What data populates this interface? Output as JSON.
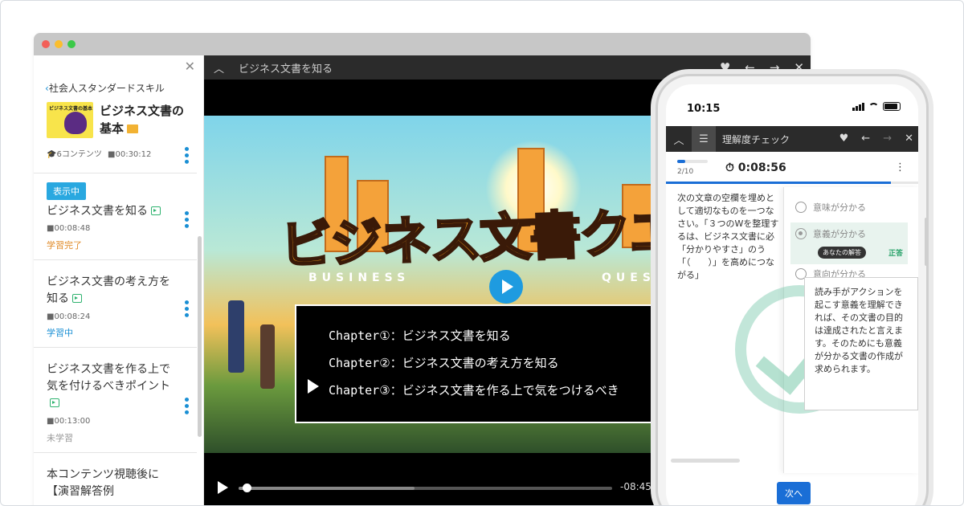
{
  "colors": {
    "accent": "#29a8e0",
    "phone_accent": "#1a6ed6",
    "done": "#e08a26",
    "learning": "#1a8fd4",
    "not_started": "#999999",
    "correct": "#2aa36b"
  },
  "sidebar": {
    "back_label": "社会人スタンダードスキル",
    "course_title": "ビジネス文書の基本",
    "thumb_text": "ビジネス文書の基本",
    "meta_contents": "6コンテンツ",
    "meta_time": "00:30:12",
    "showing_badge": "表示中",
    "items": [
      {
        "title": "ビジネス文書を知る",
        "time": "00:08:48",
        "status": "学習完了"
      },
      {
        "title": "ビジネス文書の考え方を知る",
        "time": "00:08:24",
        "status": "学習中"
      },
      {
        "title": "ビジネス文書を作る上で気を付けるべきポイント",
        "time": "00:13:00",
        "status": "未学習"
      },
      {
        "title": "本コンテンツ視聴後に【演習解答例",
        "time": "",
        "status": ""
      }
    ]
  },
  "player": {
    "title": "ビジネス文書を知る",
    "video_title": "ビジネス文書クエスト",
    "video_sub_left": "BUSINESS",
    "video_sub_right": "QUEST",
    "chapters": [
      "Chapter①：ビジネス文書を知る",
      "Chapter②：ビジネス文書の考え方を知る",
      "Chapter③：ビジネス文書を作る上で気をつけるべき"
    ],
    "time_remaining": "-08:45",
    "progress": 0.01,
    "buffered": 0.47
  },
  "phone": {
    "clock": "10:15",
    "header_title": "理解度チェック",
    "count": "2/10",
    "timer": "0:08:56",
    "question": "次の文章の空欄を埋めとして適切なものを一つなさい。「３つのWを整理するは、ビジネス文書に必「分かりやすさ」のう「（　　）」を高めにつながる」",
    "options": [
      "意味が分かる",
      "意義が分かる",
      "意向が分かる"
    ],
    "your_answer_label": "あなたの解答",
    "correct_label": "正答",
    "explanation": "読み手がアクションを起こす意義を理解できれば、その文書の目的は達成されたと言えます。そのためにも意義が分かる文書の作成が求められます。",
    "next_label": "次へ"
  }
}
